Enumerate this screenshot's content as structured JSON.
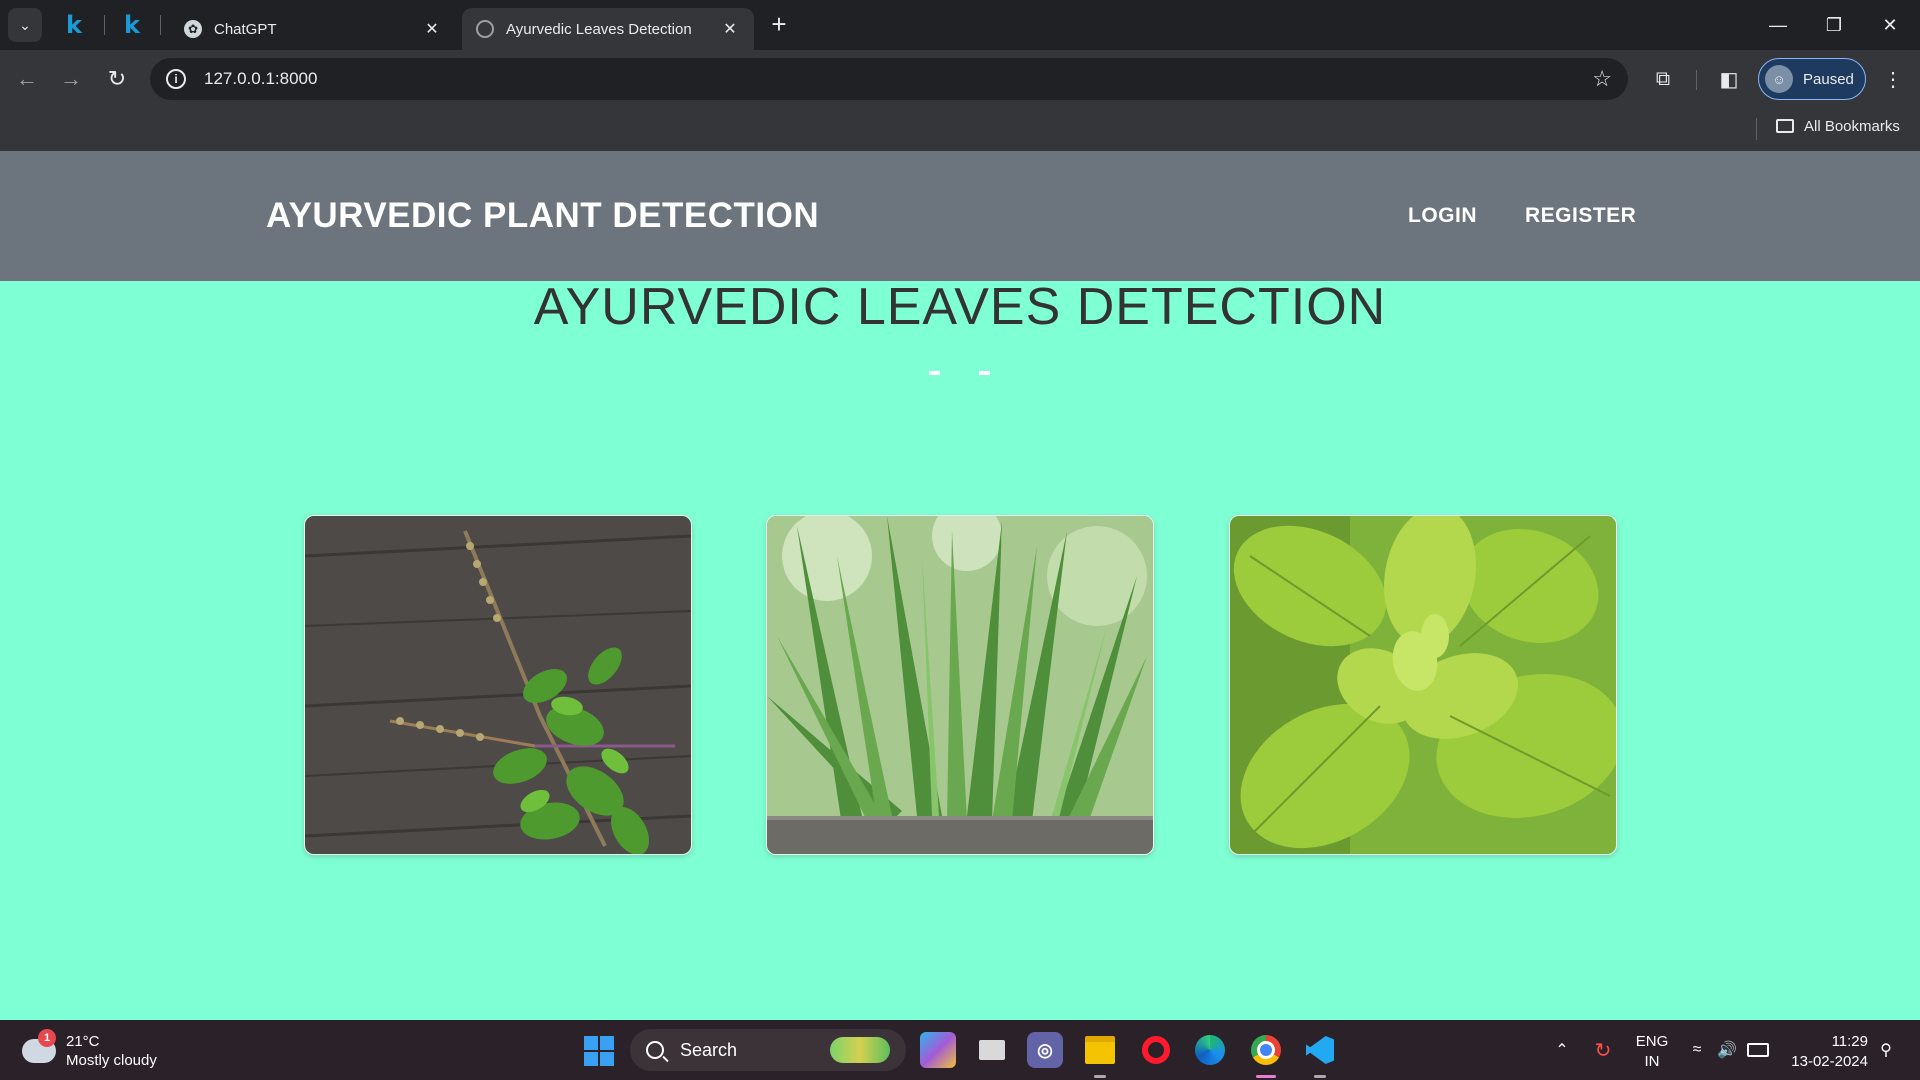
{
  "browser": {
    "pinned_tabs": [
      "k",
      "k"
    ],
    "tabs": [
      {
        "title": "ChatGPT"
      },
      {
        "title": "Ayurvedic Leaves Detection"
      }
    ],
    "url": "127.0.0.1:8000",
    "profile_label": "Paused",
    "bookmarks_label": "All Bookmarks"
  },
  "site": {
    "brand": "AYURVEDIC PLANT DETECTION",
    "nav": {
      "login": "LOGIN",
      "register": "REGISTER"
    },
    "title": "AYURVEDIC LEAVES DETECTION"
  },
  "cards": [
    {
      "plant": "tulsi"
    },
    {
      "plant": "aloe vera"
    },
    {
      "plant": "ajwain leaves"
    }
  ],
  "taskbar": {
    "weather_temp": "21°C",
    "weather_desc": "Mostly cloudy",
    "weather_badge": "1",
    "search_label": "Search",
    "lang_1": "ENG",
    "lang_2": "IN",
    "time": "11:29",
    "date": "13-02-2024"
  },
  "colors": {
    "page_bg": "#7fffd4",
    "header_bg": "#6c757d",
    "tabstrip_bg": "#202124",
    "toolbar_bg": "#35363a"
  }
}
